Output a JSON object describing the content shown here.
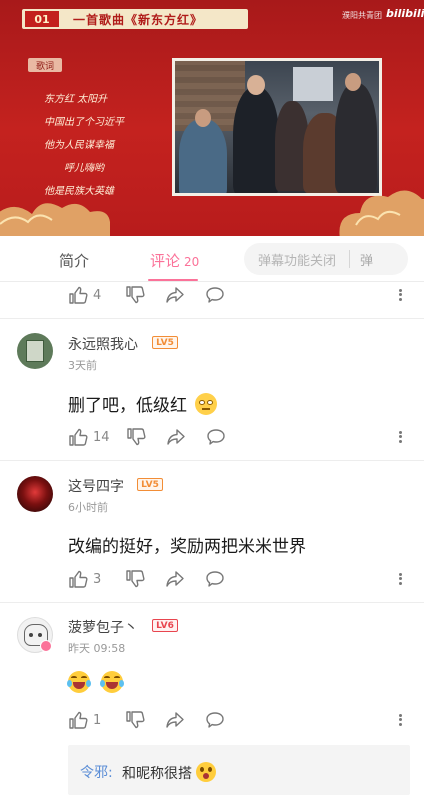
{
  "video": {
    "badge_number": "01",
    "badge_title": "一首歌曲《新东方红》",
    "channel": "濮阳共青团",
    "logo": "bilibili",
    "lyric_tag": "歌词",
    "lyrics": [
      "东方红 太阳升",
      "中国出了个习近平",
      "他为人民谋幸福",
      "呼儿嗨哟",
      "他是民族大英雄"
    ]
  },
  "tabs": {
    "intro": "简介",
    "comments": "评论",
    "comments_count": "20",
    "danmaku_status": "弹幕功能关闭",
    "danmaku_button": "弹"
  },
  "top_actions": {
    "likes": "4"
  },
  "comments": [
    {
      "username": "永远照我心",
      "level": "LV5",
      "time": "3天前",
      "content": "删了吧，低级红",
      "likes": "14"
    },
    {
      "username": "这号四字",
      "level": "LV5",
      "time": "6小时前",
      "content": "改编的挺好，奖励两把米米世界",
      "likes": "3"
    },
    {
      "username": "菠萝包子丶",
      "level": "LV6",
      "time": "昨天 09:58",
      "content": "",
      "likes": "1",
      "reply": {
        "name": "令邪:",
        "text": "和昵称很搭"
      }
    }
  ],
  "colors": {
    "accent": "#fb7299",
    "video_red": "#c4221f",
    "level5": "#f28d36",
    "level6": "#e8454f",
    "reply_name": "#5a8dd6"
  },
  "icons": [
    "thumbs-up-icon",
    "thumbs-down-icon",
    "share-icon",
    "comment-icon",
    "more-icon",
    "laughing-emoji-icon",
    "eye-roll-emoji-icon",
    "surprised-emoji-icon"
  ]
}
